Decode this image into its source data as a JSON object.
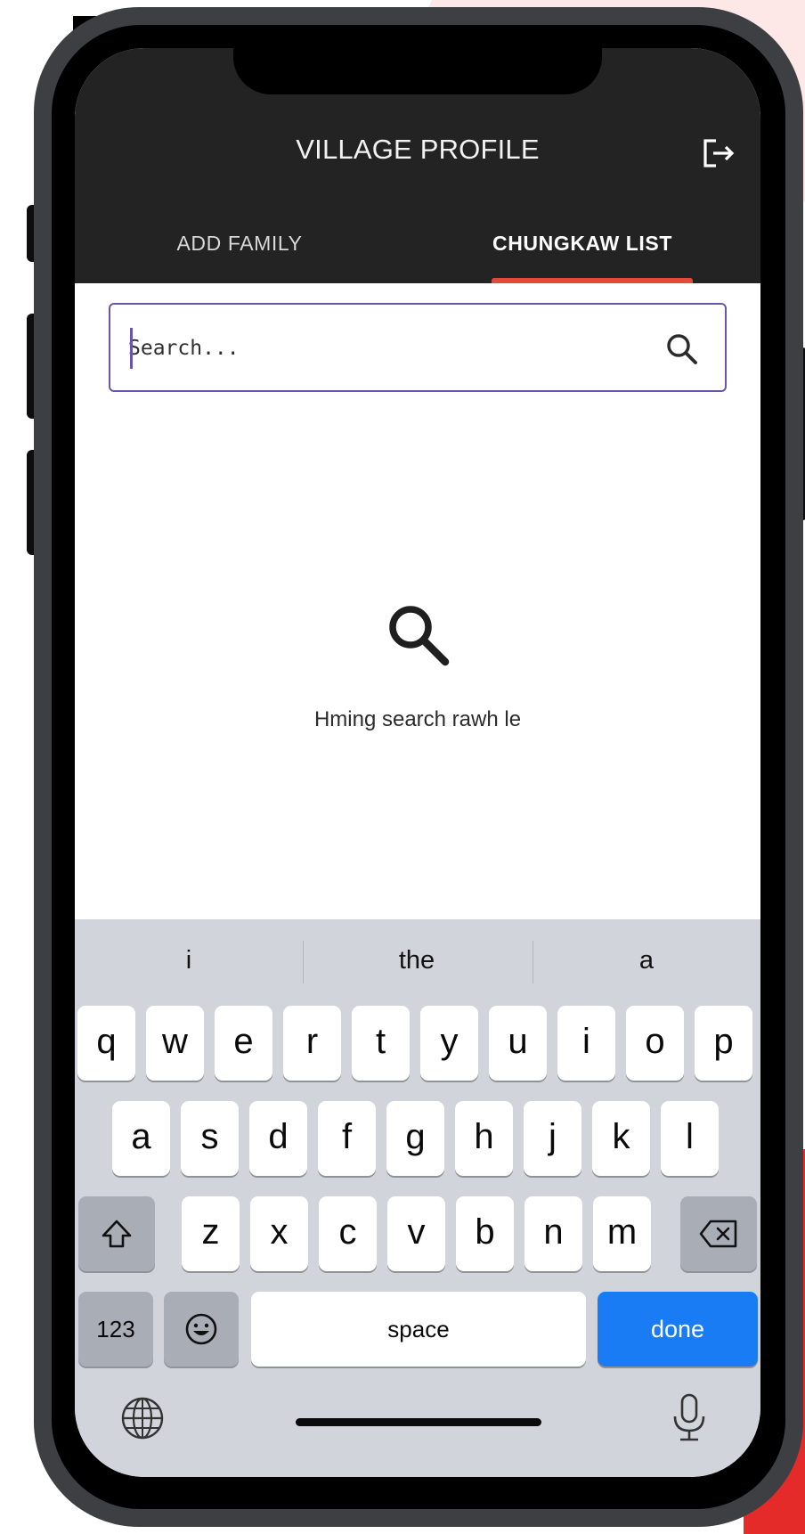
{
  "app": {
    "title": "VILLAGE PROFILE",
    "logout_icon": "logout-icon"
  },
  "tabs": [
    {
      "label": "ADD FAMILY",
      "active": false
    },
    {
      "label": "CHUNGKAW LIST",
      "active": true
    }
  ],
  "search": {
    "placeholder": "Search...",
    "value": "",
    "icon": "search-icon"
  },
  "empty_state": {
    "icon": "search-icon",
    "message": "Hming search rawh le"
  },
  "keyboard": {
    "suggestions": [
      "i",
      "the",
      "a"
    ],
    "row1": [
      "q",
      "w",
      "e",
      "r",
      "t",
      "y",
      "u",
      "i",
      "o",
      "p"
    ],
    "row2": [
      "a",
      "s",
      "d",
      "f",
      "g",
      "h",
      "j",
      "k",
      "l"
    ],
    "row3": [
      "z",
      "x",
      "c",
      "v",
      "b",
      "n",
      "m"
    ],
    "numbers_label": "123",
    "space_label": "space",
    "done_label": "done",
    "shift_icon": "shift-icon",
    "backspace_icon": "backspace-icon",
    "emoji_icon": "emoji-icon",
    "globe_icon": "globe-icon",
    "mic_icon": "microphone-icon"
  },
  "colors": {
    "appbar": "#232323",
    "tab_indicator": "#e24a3d",
    "search_border": "#6b55a8",
    "done_key": "#1a7cf5",
    "keyboard_bg": "#d1d4da"
  }
}
